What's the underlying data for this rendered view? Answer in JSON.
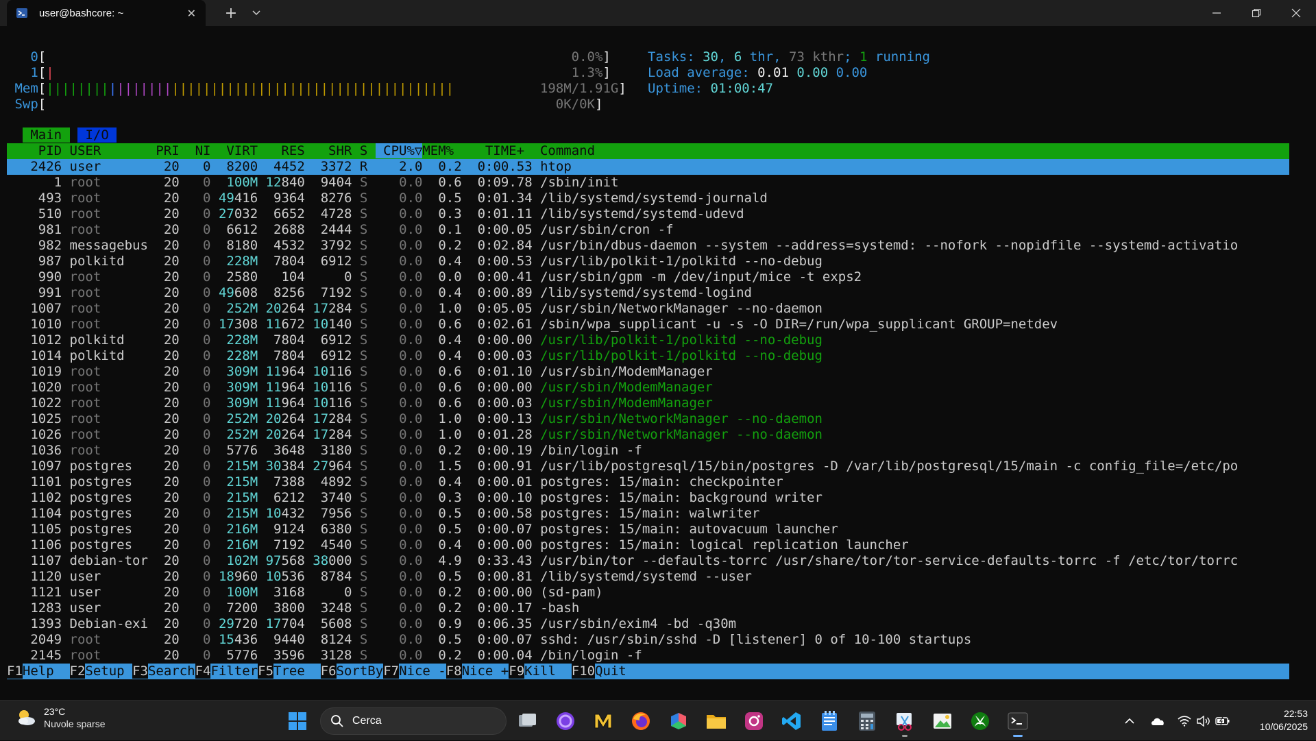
{
  "window": {
    "tab_title": "user@bashcore: ~",
    "new_tab": "+",
    "tab_close": "✕"
  },
  "htop": {
    "meters": {
      "cpu0_label": "0",
      "cpu0_value": "0.0%",
      "cpu1_label": "1",
      "cpu1_value": "1.3%",
      "mem_label": "Mem",
      "mem_value": "198M/1.91G",
      "swp_label": "Swp",
      "swp_value": "0K/0K"
    },
    "stats": {
      "tasks_label": "Tasks:",
      "tasks": "30",
      "thr": "6",
      "thr_label": "thr",
      "kthr": "73 kthr",
      "running": "1",
      "running_label": "running",
      "load_label": "Load average:",
      "load1": "0.01",
      "load5": "0.00",
      "load15": "0.00",
      "uptime_label": "Uptime:",
      "uptime": "01:00:47"
    },
    "tabs": [
      "Main",
      "I/O"
    ],
    "columns": {
      "pid": "PID",
      "user": "USER",
      "pri": "PRI",
      "ni": "NI",
      "virt": "VIRT",
      "res": "RES",
      "shr": "SHR",
      "s": "S",
      "cpu": "CPU%▽",
      "mem": "MEM%",
      "time": "TIME+",
      "command": "Command"
    },
    "processes": [
      {
        "pid": "2426",
        "user": "user",
        "pri": "20",
        "ni": "0",
        "virt": "8200",
        "res": "4452",
        "shr": "3372",
        "s": "R",
        "cpu": "2.0",
        "mem": "0.2",
        "time": "0:00.53",
        "cmd": "htop"
      },
      {
        "pid": "1",
        "user": "root",
        "pri": "20",
        "ni": "0",
        "virt": "100M",
        "res": "12840",
        "shr": "9404",
        "s": "S",
        "cpu": "0.0",
        "mem": "0.6",
        "time": "0:09.78",
        "cmd": "/sbin/init"
      },
      {
        "pid": "493",
        "user": "root",
        "pri": "20",
        "ni": "0",
        "virt": "49416",
        "res": "9364",
        "shr": "8276",
        "s": "S",
        "cpu": "0.0",
        "mem": "0.5",
        "time": "0:01.34",
        "cmd": "/lib/systemd/systemd-journald"
      },
      {
        "pid": "510",
        "user": "root",
        "pri": "20",
        "ni": "0",
        "virt": "27032",
        "res": "6652",
        "shr": "4728",
        "s": "S",
        "cpu": "0.0",
        "mem": "0.3",
        "time": "0:01.11",
        "cmd": "/lib/systemd/systemd-udevd"
      },
      {
        "pid": "981",
        "user": "root",
        "pri": "20",
        "ni": "0",
        "virt": "6612",
        "res": "2688",
        "shr": "2444",
        "s": "S",
        "cpu": "0.0",
        "mem": "0.1",
        "time": "0:00.05",
        "cmd": "/usr/sbin/cron -f"
      },
      {
        "pid": "982",
        "user": "messagebus",
        "pri": "20",
        "ni": "0",
        "virt": "8180",
        "res": "4532",
        "shr": "3792",
        "s": "S",
        "cpu": "0.0",
        "mem": "0.2",
        "time": "0:02.84",
        "cmd": "/usr/bin/dbus-daemon --system --address=systemd: --nofork --nopidfile --systemd-activatio"
      },
      {
        "pid": "987",
        "user": "polkitd",
        "pri": "20",
        "ni": "0",
        "virt": "228M",
        "res": "7804",
        "shr": "6912",
        "s": "S",
        "cpu": "0.0",
        "mem": "0.4",
        "time": "0:00.53",
        "cmd": "/usr/lib/polkit-1/polkitd --no-debug"
      },
      {
        "pid": "990",
        "user": "root",
        "pri": "20",
        "ni": "0",
        "virt": "2580",
        "res": "104",
        "shr": "0",
        "s": "S",
        "cpu": "0.0",
        "mem": "0.0",
        "time": "0:00.41",
        "cmd": "/usr/sbin/gpm -m /dev/input/mice -t exps2"
      },
      {
        "pid": "991",
        "user": "root",
        "pri": "20",
        "ni": "0",
        "virt": "49608",
        "res": "8256",
        "shr": "7192",
        "s": "S",
        "cpu": "0.0",
        "mem": "0.4",
        "time": "0:00.89",
        "cmd": "/lib/systemd/systemd-logind"
      },
      {
        "pid": "1007",
        "user": "root",
        "pri": "20",
        "ni": "0",
        "virt": "252M",
        "res": "20264",
        "shr": "17284",
        "s": "S",
        "cpu": "0.0",
        "mem": "1.0",
        "time": "0:05.05",
        "cmd": "/usr/sbin/NetworkManager --no-daemon"
      },
      {
        "pid": "1010",
        "user": "root",
        "pri": "20",
        "ni": "0",
        "virt": "17308",
        "res": "11672",
        "shr": "10140",
        "s": "S",
        "cpu": "0.0",
        "mem": "0.6",
        "time": "0:02.61",
        "cmd": "/sbin/wpa_supplicant -u -s -O DIR=/run/wpa_supplicant GROUP=netdev"
      },
      {
        "pid": "1012",
        "user": "polkitd",
        "pri": "20",
        "ni": "0",
        "virt": "228M",
        "res": "7804",
        "shr": "6912",
        "s": "S",
        "cpu": "0.0",
        "mem": "0.4",
        "time": "0:00.00",
        "cmd": "/usr/lib/polkit-1/polkitd --no-debug",
        "thread": true
      },
      {
        "pid": "1014",
        "user": "polkitd",
        "pri": "20",
        "ni": "0",
        "virt": "228M",
        "res": "7804",
        "shr": "6912",
        "s": "S",
        "cpu": "0.0",
        "mem": "0.4",
        "time": "0:00.03",
        "cmd": "/usr/lib/polkit-1/polkitd --no-debug",
        "thread": true
      },
      {
        "pid": "1019",
        "user": "root",
        "pri": "20",
        "ni": "0",
        "virt": "309M",
        "res": "11964",
        "shr": "10116",
        "s": "S",
        "cpu": "0.0",
        "mem": "0.6",
        "time": "0:01.10",
        "cmd": "/usr/sbin/ModemManager"
      },
      {
        "pid": "1020",
        "user": "root",
        "pri": "20",
        "ni": "0",
        "virt": "309M",
        "res": "11964",
        "shr": "10116",
        "s": "S",
        "cpu": "0.0",
        "mem": "0.6",
        "time": "0:00.00",
        "cmd": "/usr/sbin/ModemManager",
        "thread": true
      },
      {
        "pid": "1022",
        "user": "root",
        "pri": "20",
        "ni": "0",
        "virt": "309M",
        "res": "11964",
        "shr": "10116",
        "s": "S",
        "cpu": "0.0",
        "mem": "0.6",
        "time": "0:00.03",
        "cmd": "/usr/sbin/ModemManager",
        "thread": true
      },
      {
        "pid": "1025",
        "user": "root",
        "pri": "20",
        "ni": "0",
        "virt": "252M",
        "res": "20264",
        "shr": "17284",
        "s": "S",
        "cpu": "0.0",
        "mem": "1.0",
        "time": "0:00.13",
        "cmd": "/usr/sbin/NetworkManager --no-daemon",
        "thread": true
      },
      {
        "pid": "1026",
        "user": "root",
        "pri": "20",
        "ni": "0",
        "virt": "252M",
        "res": "20264",
        "shr": "17284",
        "s": "S",
        "cpu": "0.0",
        "mem": "1.0",
        "time": "0:01.28",
        "cmd": "/usr/sbin/NetworkManager --no-daemon",
        "thread": true
      },
      {
        "pid": "1036",
        "user": "root",
        "pri": "20",
        "ni": "0",
        "virt": "5776",
        "res": "3648",
        "shr": "3180",
        "s": "S",
        "cpu": "0.0",
        "mem": "0.2",
        "time": "0:00.19",
        "cmd": "/bin/login -f"
      },
      {
        "pid": "1097",
        "user": "postgres",
        "pri": "20",
        "ni": "0",
        "virt": "215M",
        "res": "30384",
        "shr": "27964",
        "s": "S",
        "cpu": "0.0",
        "mem": "1.5",
        "time": "0:00.91",
        "cmd": "/usr/lib/postgresql/15/bin/postgres -D /var/lib/postgresql/15/main -c config_file=/etc/po"
      },
      {
        "pid": "1101",
        "user": "postgres",
        "pri": "20",
        "ni": "0",
        "virt": "215M",
        "res": "7388",
        "shr": "4892",
        "s": "S",
        "cpu": "0.0",
        "mem": "0.4",
        "time": "0:00.01",
        "cmd": "postgres: 15/main: checkpointer"
      },
      {
        "pid": "1102",
        "user": "postgres",
        "pri": "20",
        "ni": "0",
        "virt": "215M",
        "res": "6212",
        "shr": "3740",
        "s": "S",
        "cpu": "0.0",
        "mem": "0.3",
        "time": "0:00.10",
        "cmd": "postgres: 15/main: background writer"
      },
      {
        "pid": "1104",
        "user": "postgres",
        "pri": "20",
        "ni": "0",
        "virt": "215M",
        "res": "10432",
        "shr": "7956",
        "s": "S",
        "cpu": "0.0",
        "mem": "0.5",
        "time": "0:00.58",
        "cmd": "postgres: 15/main: walwriter"
      },
      {
        "pid": "1105",
        "user": "postgres",
        "pri": "20",
        "ni": "0",
        "virt": "216M",
        "res": "9124",
        "shr": "6380",
        "s": "S",
        "cpu": "0.0",
        "mem": "0.5",
        "time": "0:00.07",
        "cmd": "postgres: 15/main: autovacuum launcher"
      },
      {
        "pid": "1106",
        "user": "postgres",
        "pri": "20",
        "ni": "0",
        "virt": "216M",
        "res": "7192",
        "shr": "4540",
        "s": "S",
        "cpu": "0.0",
        "mem": "0.4",
        "time": "0:00.00",
        "cmd": "postgres: 15/main: logical replication launcher"
      },
      {
        "pid": "1107",
        "user": "debian-tor",
        "pri": "20",
        "ni": "0",
        "virt": "102M",
        "res": "97568",
        "shr": "38000",
        "s": "S",
        "cpu": "0.0",
        "mem": "4.9",
        "time": "0:33.43",
        "cmd": "/usr/bin/tor --defaults-torrc /usr/share/tor/tor-service-defaults-torrc -f /etc/tor/torrc"
      },
      {
        "pid": "1120",
        "user": "user",
        "pri": "20",
        "ni": "0",
        "virt": "18960",
        "res": "10536",
        "shr": "8784",
        "s": "S",
        "cpu": "0.0",
        "mem": "0.5",
        "time": "0:00.81",
        "cmd": "/lib/systemd/systemd --user"
      },
      {
        "pid": "1121",
        "user": "user",
        "pri": "20",
        "ni": "0",
        "virt": "100M",
        "res": "3168",
        "shr": "0",
        "s": "S",
        "cpu": "0.0",
        "mem": "0.2",
        "time": "0:00.00",
        "cmd": "(sd-pam)"
      },
      {
        "pid": "1283",
        "user": "user",
        "pri": "20",
        "ni": "0",
        "virt": "7200",
        "res": "3800",
        "shr": "3248",
        "s": "S",
        "cpu": "0.0",
        "mem": "0.2",
        "time": "0:00.17",
        "cmd": "-bash"
      },
      {
        "pid": "1393",
        "user": "Debian-exi",
        "pri": "20",
        "ni": "0",
        "virt": "29720",
        "res": "17704",
        "shr": "5608",
        "s": "S",
        "cpu": "0.0",
        "mem": "0.9",
        "time": "0:06.35",
        "cmd": "/usr/sbin/exim4 -bd -q30m"
      },
      {
        "pid": "2049",
        "user": "root",
        "pri": "20",
        "ni": "0",
        "virt": "15436",
        "res": "9440",
        "shr": "8124",
        "s": "S",
        "cpu": "0.0",
        "mem": "0.5",
        "time": "0:00.07",
        "cmd": "sshd: /usr/sbin/sshd -D [listener] 0 of 10-100 startups"
      },
      {
        "pid": "2145",
        "user": "root",
        "pri": "20",
        "ni": "0",
        "virt": "5776",
        "res": "3596",
        "shr": "3128",
        "s": "S",
        "cpu": "0.0",
        "mem": "0.2",
        "time": "0:00.04",
        "cmd": "/bin/login -f"
      }
    ],
    "fkeys": [
      {
        "key": "F1",
        "label": "Help  "
      },
      {
        "key": "F2",
        "label": "Setup "
      },
      {
        "key": "F3",
        "label": "Search"
      },
      {
        "key": "F4",
        "label": "Filter"
      },
      {
        "key": "F5",
        "label": "Tree  "
      },
      {
        "key": "F6",
        "label": "SortBy"
      },
      {
        "key": "F7",
        "label": "Nice -"
      },
      {
        "key": "F8",
        "label": "Nice +"
      },
      {
        "key": "F9",
        "label": "Kill  "
      },
      {
        "key": "F10",
        "label": "Quit"
      }
    ]
  },
  "taskbar": {
    "weather_temp": "23°C",
    "weather_desc": "Nuvole sparse",
    "search_label": "Cerca",
    "apps": [
      "task-view-icon",
      "copilot-icon",
      "mail-icon",
      "firefox-icon",
      "office-icon",
      "file-explorer-icon",
      "instagram-icon",
      "vscode-icon",
      "notepad-icon",
      "calculator-icon",
      "snipping-tool-icon",
      "paint-icon",
      "xbox-icon",
      "terminal-icon"
    ],
    "time": "22:53",
    "date": "10/06/2025"
  },
  "colors": {
    "header_green": "#13a10e",
    "selection_blue": "#3a96dd",
    "terminal_bg": "#0c0c0c"
  }
}
